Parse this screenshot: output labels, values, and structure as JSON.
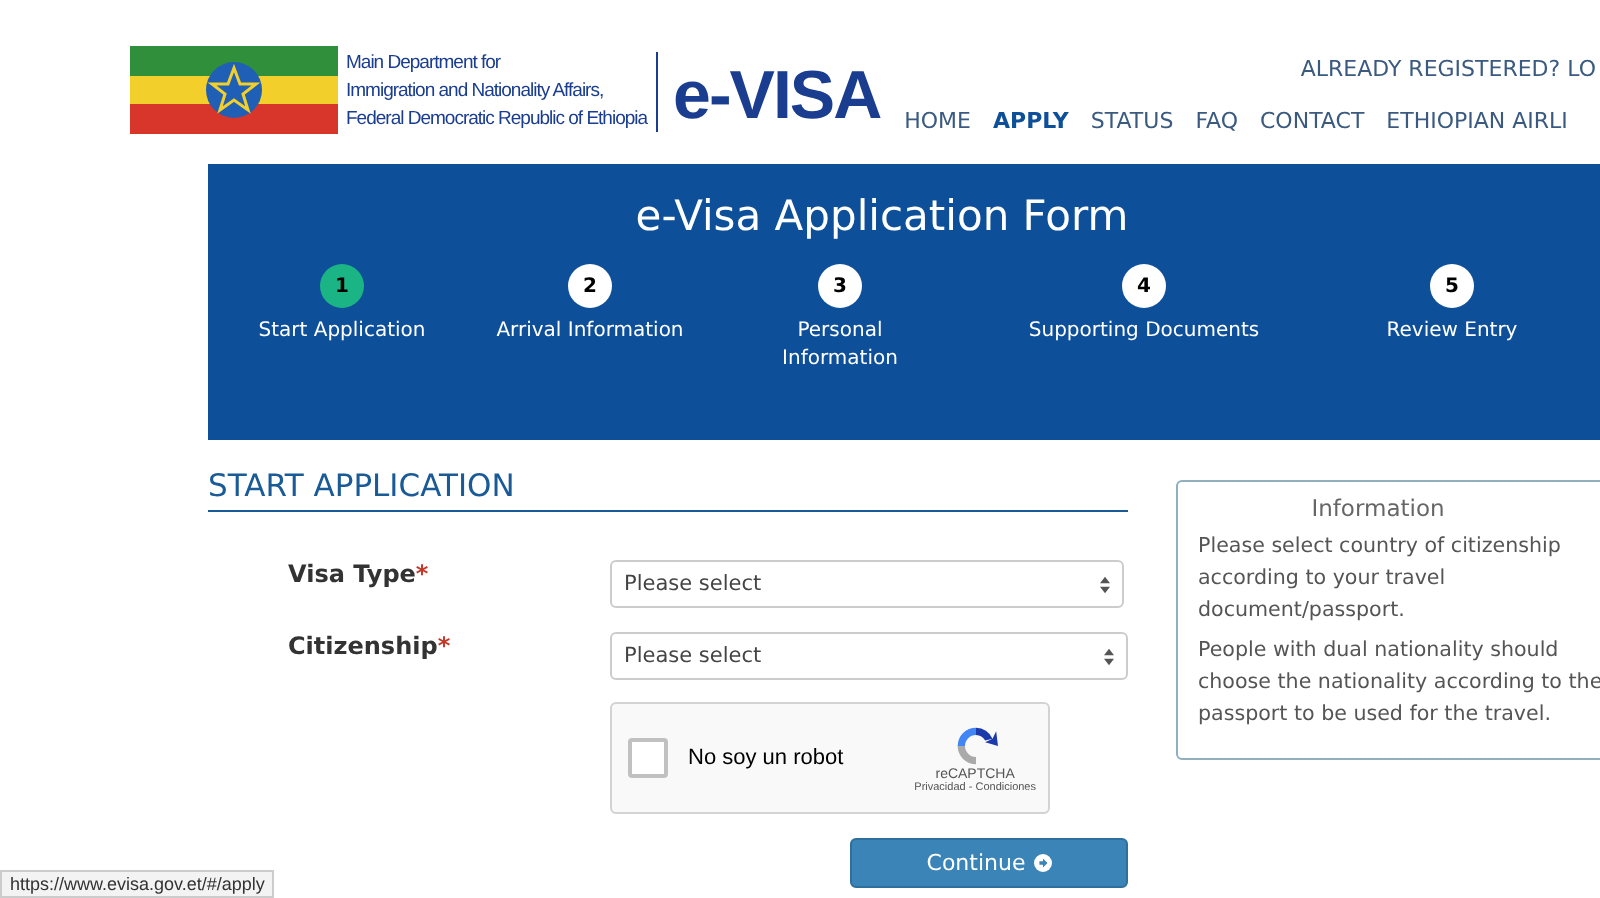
{
  "header": {
    "department_lines": [
      "Main Department for",
      "Immigration and Nationality Affairs,",
      "Federal Democratic Republic of Ethiopia"
    ],
    "logo_text": "e-VISA",
    "login_link": "ALREADY REGISTERED? LO",
    "nav": [
      {
        "label": "HOME",
        "selected": false
      },
      {
        "label": "APPLY",
        "selected": true
      },
      {
        "label": "STATUS",
        "selected": false
      },
      {
        "label": "FAQ",
        "selected": false
      },
      {
        "label": "CONTACT",
        "selected": false
      },
      {
        "label": "ETHIOPIAN AIRLI",
        "selected": false
      }
    ]
  },
  "banner": {
    "title": "e-Visa Application Form",
    "steps": [
      {
        "number": "1",
        "label": "Start Application",
        "selected": true
      },
      {
        "number": "2",
        "label": "Arrival Information",
        "selected": false
      },
      {
        "number": "3",
        "label": "Personal Information",
        "selected": false
      },
      {
        "number": "4",
        "label": "Supporting Documents",
        "selected": false
      },
      {
        "number": "5",
        "label": "Review Entry",
        "selected": false
      }
    ]
  },
  "form": {
    "heading": "START APPLICATION",
    "fields": [
      {
        "label": "Visa Type",
        "required_mark": "*",
        "placeholder": "Please select"
      },
      {
        "label": "Citizenship",
        "required_mark": "*",
        "placeholder": "Please select"
      }
    ],
    "captcha": {
      "label": "No soy un robot",
      "checked": false,
      "brand": "reCAPTCHA",
      "links": "Privacidad - Condiciones"
    },
    "continue_button": "Continue"
  },
  "info": {
    "title": "Information",
    "paragraphs": [
      "Please select country of citizenship according to your travel document/passport.",
      "People with dual nationality should choose the nationality according to the passport to be used for the travel."
    ]
  },
  "status_url": "https://www.evisa.gov.et/#/apply"
}
